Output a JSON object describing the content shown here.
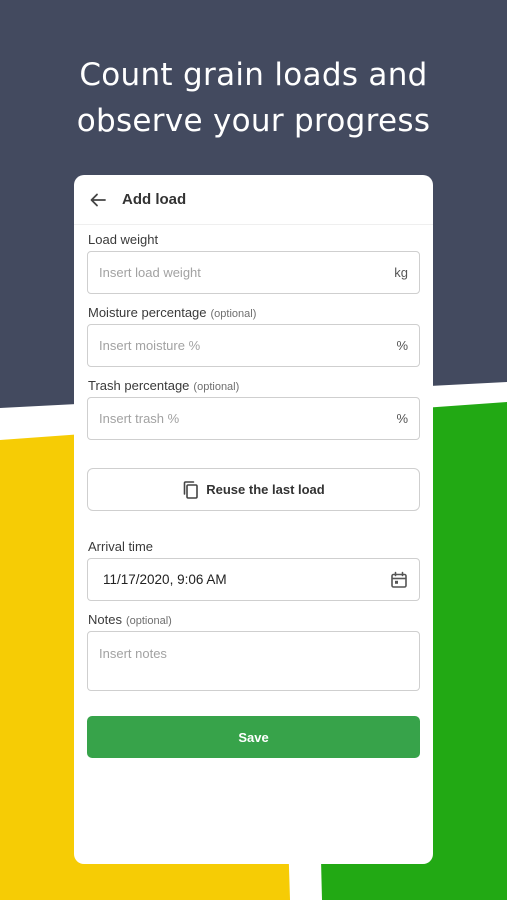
{
  "promo": {
    "headline_line1": "Count grain loads and",
    "headline_line2": "observe your progress"
  },
  "colors": {
    "top_background": "#434a5f",
    "yellow": "#f6cc05",
    "green": "#22a914",
    "save_button": "#37a34a"
  },
  "app_bar": {
    "back_icon": "arrow-left-icon",
    "title": "Add load"
  },
  "form": {
    "load_weight": {
      "label": "Load weight",
      "placeholder": "Insert load weight",
      "unit": "kg"
    },
    "moisture": {
      "label": "Moisture percentage",
      "optional": "(optional)",
      "placeholder": "Insert moisture %",
      "unit": "%"
    },
    "trash": {
      "label": "Trash percentage",
      "optional": "(optional)",
      "placeholder": "Insert trash %",
      "unit": "%"
    },
    "reuse_button": {
      "icon": "copy-icon",
      "label": "Reuse the last load"
    },
    "arrival_time": {
      "label": "Arrival time",
      "value": "11/17/2020, 9:06 AM",
      "icon": "calendar-icon"
    },
    "notes": {
      "label": "Notes",
      "optional": "(optional)",
      "placeholder": "Insert notes"
    },
    "save_button": {
      "label": "Save"
    }
  }
}
